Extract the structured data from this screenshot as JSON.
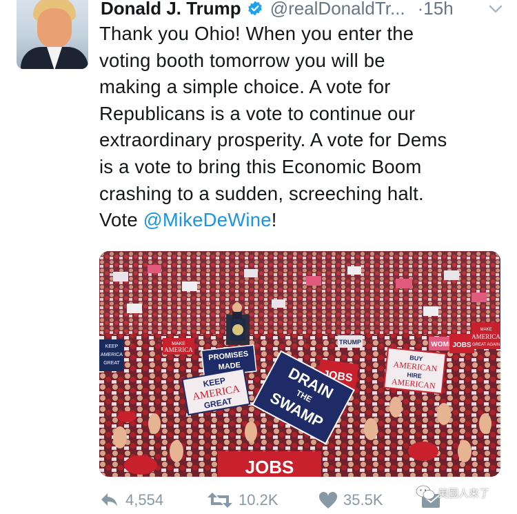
{
  "tweet": {
    "author_name": "Donald J. Trump",
    "handle": "@realDonaldTr...",
    "time": "·15h",
    "text_lines": [
      "Thank you Ohio! When you enter the",
      "voting booth tomorrow you will be",
      "making a simple choice. A vote for",
      "Republicans is a vote to continue our",
      "extraordinary prosperity. A vote for Dems",
      "is a vote to bring this Economic Boom",
      "crashing to a sudden, screeching halt."
    ],
    "last_line_prefix": "Vote ",
    "mention": "@MikeDeWine",
    "last_line_suffix": "!"
  },
  "photo": {
    "signs": {
      "drain": [
        "DRAIN",
        "THE",
        "SWAMP"
      ],
      "kag": [
        "KEEP",
        "AMERICA",
        "GREAT"
      ],
      "promises": [
        "PROMISES",
        "MADE"
      ],
      "buy": [
        "BUY",
        "AMERICAN",
        "HIRE",
        "AMERICAN"
      ],
      "jobs_bottom": "JOBS",
      "jobs_mid": "JOBS",
      "make_left": [
        "MAKE",
        "AMERICA"
      ],
      "make_right": [
        "MAKE",
        "AMERICA",
        "GREAT AGAIN"
      ],
      "jobs_right": "JOBS",
      "women_right": "WOMEN",
      "trump_small": "TRUMP",
      "keep_left": [
        "KEEP",
        "AMERICA",
        "GREAT"
      ]
    }
  },
  "actions": {
    "replies": "4,554",
    "retweets": "10.2K",
    "likes": "35.5K"
  },
  "watermark": "美国人来了",
  "colors": {
    "link": "#1b95e0",
    "muted": "#8899a6",
    "verified": "#1da1f2"
  },
  "icons": [
    "reply-icon",
    "retweet-icon",
    "heart-icon",
    "dm-icon",
    "verified-icon",
    "caret-down-icon"
  ]
}
